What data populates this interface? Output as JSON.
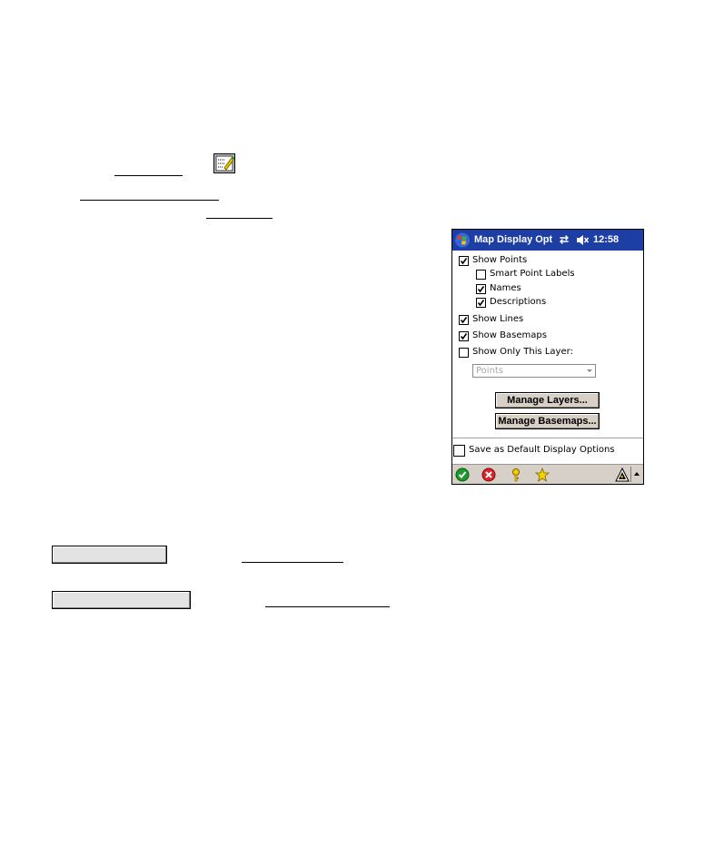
{
  "window": {
    "title": "Map Display Option",
    "time": "12:58",
    "sync_icon": "⇄"
  },
  "options": {
    "show_points": {
      "label": "Show Points",
      "checked": true
    },
    "smart_point_labels": {
      "label": "Smart Point Labels",
      "checked": false
    },
    "names": {
      "label": "Names",
      "checked": true
    },
    "descriptions": {
      "label": "Descriptions",
      "checked": true
    },
    "show_lines": {
      "label": "Show Lines",
      "checked": true
    },
    "show_basemaps": {
      "label": "Show Basemaps",
      "checked": true
    },
    "show_only_this_layer": {
      "label": "Show Only This Layer:",
      "checked": false
    },
    "layer_select_value": "Points",
    "save_default": {
      "label": "Save as Default Display Options",
      "checked": false
    }
  },
  "buttons": {
    "manage_layers": "Manage Layers...",
    "manage_basemaps": "Manage Basemaps..."
  },
  "icons": {
    "start": "windows-flag-icon",
    "ok": "ok-check-icon",
    "cancel": "cancel-x-icon",
    "help": "help-key-icon",
    "favorites": "star-icon",
    "sip": "input-panel-icon"
  },
  "colors": {
    "titlebar": "#1d3fa5",
    "taskbar": "#d6d0c8",
    "button_face": "#d8cfc6"
  }
}
